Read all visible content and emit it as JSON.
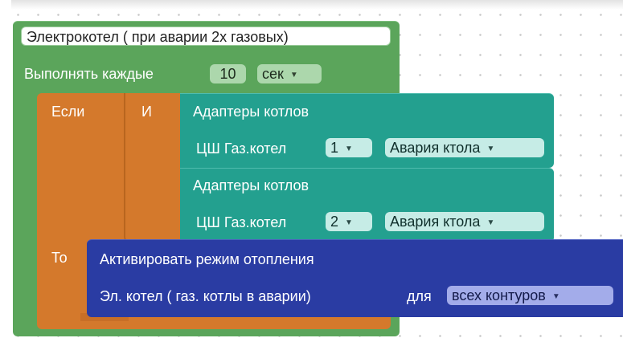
{
  "block": {
    "title": "Электрокотел ( при аварии 2х газовых)",
    "schedule_prefix": "Выполнять каждые",
    "interval_value": "10",
    "interval_unit": "сек"
  },
  "condition": {
    "if_label": "Если",
    "and_label": "И",
    "then_label": "То",
    "operands": [
      {
        "header": "Адаптеры котлов",
        "device_label": "ЦШ Газ.котел",
        "device_number": "1",
        "signal": "Авария ктола"
      },
      {
        "header": "Адаптеры котлов",
        "device_label": "ЦШ Газ.котел",
        "device_number": "2",
        "signal": "Авария ктола"
      }
    ]
  },
  "action": {
    "title": "Активировать режим отопления",
    "mode_label": "Эл. котел ( газ. котлы в аварии)",
    "for_label": "для",
    "target": "всех контуров"
  },
  "colors": {
    "event_green": "#5ba55b",
    "logic_orange": "#d4792c",
    "adapter_teal": "#23a08f",
    "action_blue": "#2a3ca3"
  },
  "icons": {
    "dropdown": "triangle-down"
  }
}
